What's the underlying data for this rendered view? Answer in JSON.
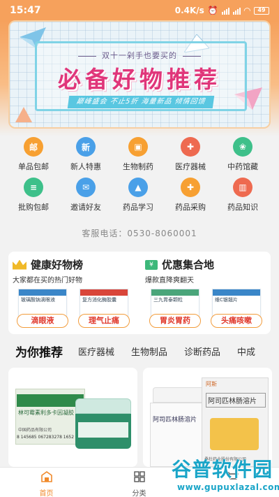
{
  "status_bar": {
    "time": "15:47",
    "network_speed": "0.4K/s",
    "battery": "49"
  },
  "banner": {
    "kicker": "双十一剁手也要买的",
    "title": "必备好物推荐",
    "tagline": "巅峰盛会 不止5折  海量新品 倾情回馈"
  },
  "shortcuts": [
    {
      "label": "单品包邮",
      "icon": "mail-badge-icon",
      "color": "#f7a032"
    },
    {
      "label": "新人特惠",
      "icon": "new-badge-icon",
      "color": "#4aa0e8"
    },
    {
      "label": "生物制药",
      "icon": "ticket-icon",
      "color": "#f7a032"
    },
    {
      "label": "医疗器械",
      "icon": "medical-kit-icon",
      "color": "#ee6a50"
    },
    {
      "label": "中药馆藏",
      "icon": "herb-icon",
      "color": "#3ec08a"
    },
    {
      "label": "批购包邮",
      "icon": "document-icon",
      "color": "#3ec08a"
    },
    {
      "label": "邀请好友",
      "icon": "envelope-icon",
      "color": "#4aa0e8"
    },
    {
      "label": "药品学习",
      "icon": "graduation-cap-icon",
      "color": "#4aa0e8"
    },
    {
      "label": "药品采购",
      "icon": "medicine-box-icon",
      "color": "#f7a032"
    },
    {
      "label": "药品知识",
      "icon": "book-icon",
      "color": "#ee6a50"
    }
  ],
  "service_phone": "客服电话：0530-8060001",
  "promo": {
    "left": {
      "title": "健康好物榜",
      "subtitle": "大家都在买的热门好物",
      "products": [
        {
          "name": "玻璃酸钠滴眼液",
          "tag": "滴眼液"
        },
        {
          "name": "复方消化酶胶囊",
          "tag": "理气止痛"
        }
      ]
    },
    "right": {
      "title": "优惠集合地",
      "subtitle": "爆款直降爽翻天",
      "products": [
        {
          "name": "三九胃泰颗粒",
          "tag": "胃炎胃药"
        },
        {
          "name": "维C银翘片",
          "tag": "头痛咳嗽"
        }
      ]
    }
  },
  "tabs": [
    "为你推荐",
    "医疗器械",
    "生物制品",
    "诊断药品",
    "中成"
  ],
  "products": [
    {
      "package_text": "林可霉素利多卡因凝胶",
      "barcode": "8 145685 067283278 1652",
      "maker": "中国药品有限公司"
    },
    {
      "package_text": "阿司匹林肠溶片",
      "brand": "阿斯",
      "maker": "桑杜药业股份有限公司"
    }
  ],
  "bottom_nav": [
    {
      "label": "首页",
      "icon": "home-icon",
      "active": true
    },
    {
      "label": "分类",
      "icon": "grid-icon",
      "active": false
    },
    {
      "label": "",
      "icon": "cart-icon",
      "active": false
    }
  ],
  "watermark": {
    "title": "谷普软件园",
    "url": "www.gupuxlazal.com"
  },
  "colors": {
    "accent": "#f6a15c",
    "banner_title": "#e0367a",
    "tag_text": "#e0392c",
    "watermark": "#1aa5c8"
  }
}
